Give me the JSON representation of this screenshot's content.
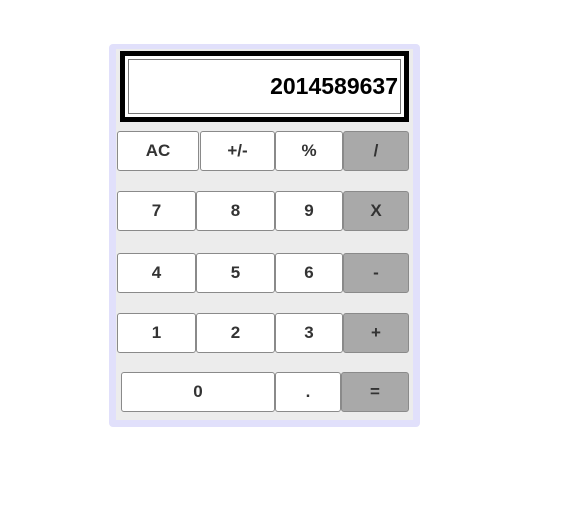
{
  "display": {
    "value": "2014589637"
  },
  "buttons": {
    "ac": "AC",
    "sign": "+/-",
    "percent": "%",
    "divide": "/",
    "n7": "7",
    "n8": "8",
    "n9": "9",
    "multiply": "X",
    "n4": "4",
    "n5": "5",
    "n6": "6",
    "minus": "-",
    "n1": "1",
    "n2": "2",
    "n3": "3",
    "plus": "+",
    "n0": "0",
    "dot": ".",
    "equals": "="
  },
  "colors": {
    "frame": "#e1e0fb",
    "panel": "#ececec",
    "operator": "#a9a9a9",
    "key": "#ffffff"
  }
}
